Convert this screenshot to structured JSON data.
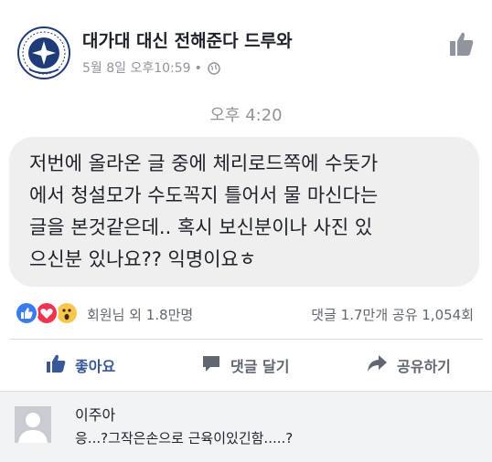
{
  "post": {
    "page_name": "대가대 대신 전해준다 드루와",
    "date": "5월 8일 오후10:59",
    "separator": "•",
    "logo_icon": "university-seal-icon",
    "like_page_icon": "thumbs-up-icon"
  },
  "message": {
    "timestamp": "오후 4:20",
    "lines": "저번에 올라온 글 중에 체리로드쪽에 수돗가\n에서 청설모가 수도꼭지 틀어서 물 마신다는\n글을 본것같은데.. 혹시 보신분이나 사진 있\n으신분 있나요?? 익명이요ㅎ"
  },
  "reactions": {
    "icons": [
      "like-reaction-icon",
      "love-reaction-icon",
      "wow-reaction-icon"
    ],
    "summary": "회원님 외 1.8만명",
    "counts": "댓글 1.7만개 공유 1,054회"
  },
  "actions": {
    "like_label": "좋아요",
    "comment_label": "댓글 달기",
    "share_label": "공유하기"
  },
  "comment": {
    "author": "이주아",
    "text": "응...?그작은손으로 근육이있긴함.....?"
  },
  "colors": {
    "like_blue": "#385898",
    "reaction_like": "#3b7bf0",
    "reaction_love": "#f0334f",
    "reaction_wow": "#f7c64a",
    "bubble_bg": "#efefef"
  }
}
